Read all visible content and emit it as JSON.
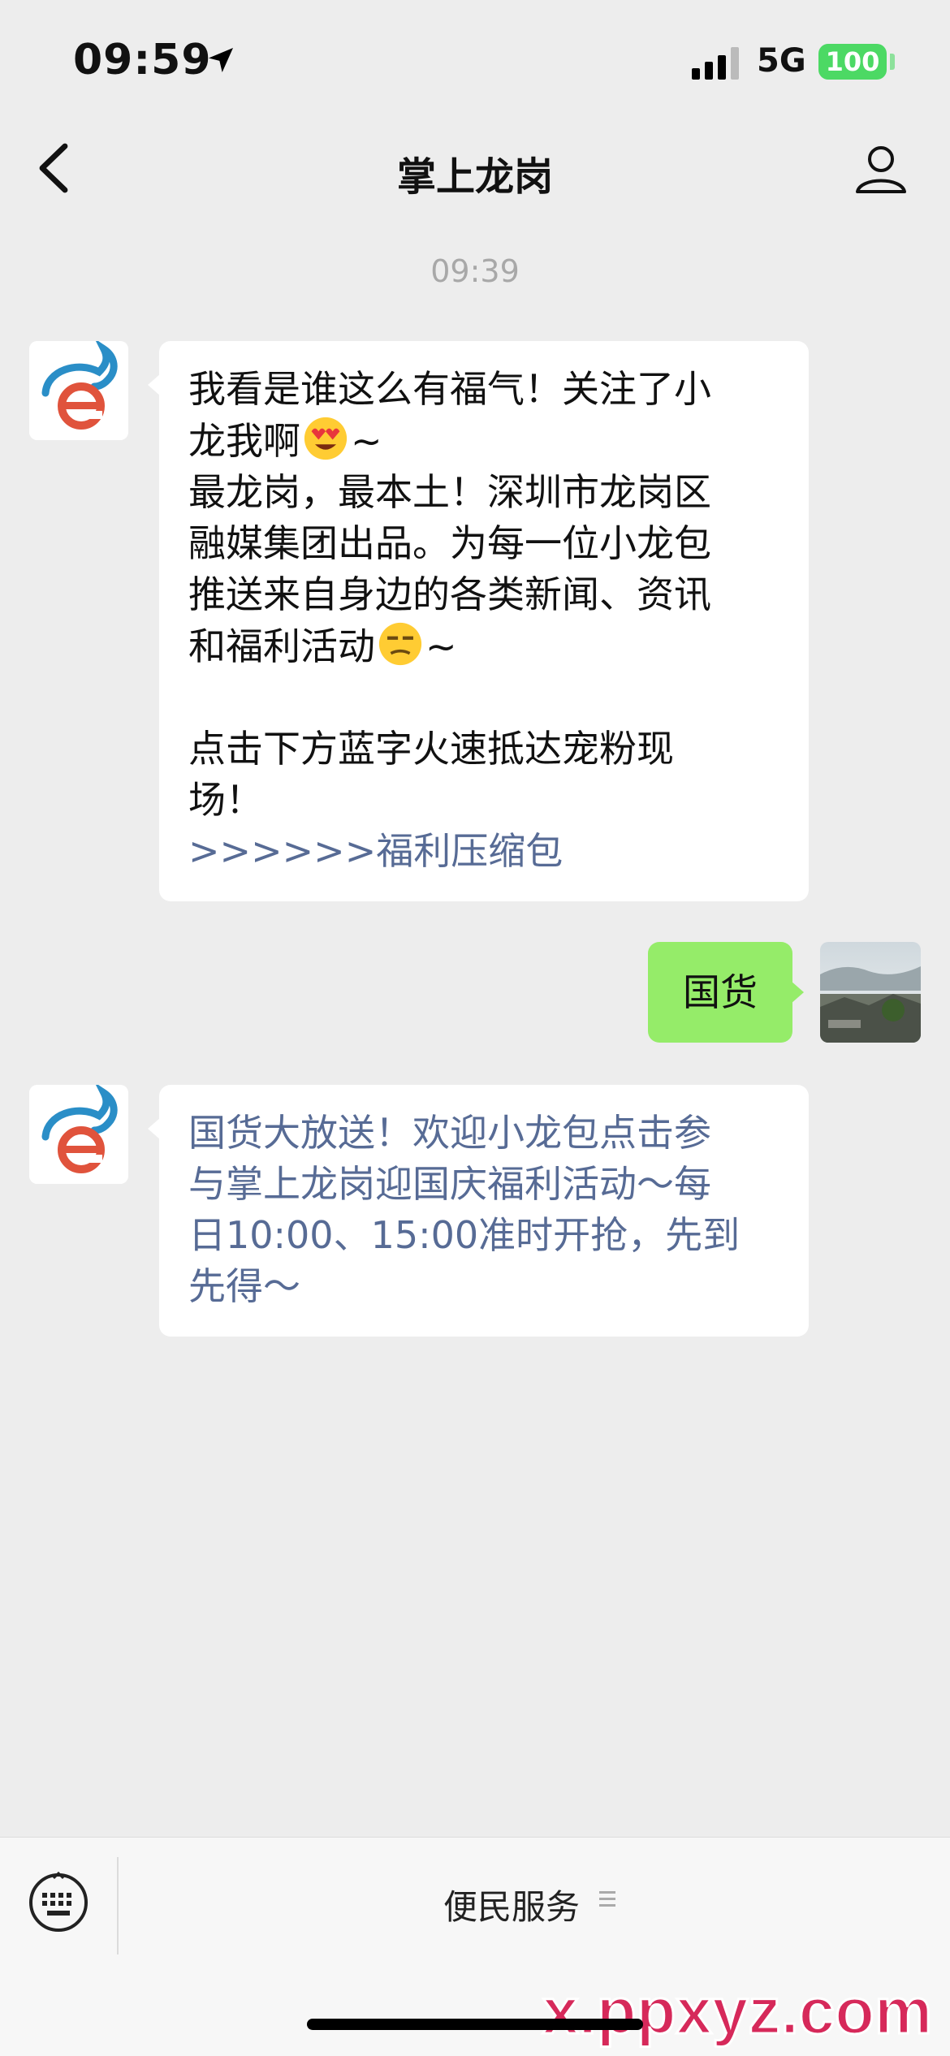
{
  "status_bar": {
    "time": "09:59",
    "network": "5G",
    "battery": "100"
  },
  "nav": {
    "title": "掌上龙岗"
  },
  "chat": {
    "timestamp": "09:39",
    "msg1": {
      "lines": [
        "我看是谁这么有福气！关注了小",
        "龙我啊",
        "最龙岗，最本土！深圳市龙岗区",
        "融媒集团出品。为每一位小龙包",
        "推送来自身边的各类新闻、资讯",
        "和福利活动",
        "点击下方蓝字火速抵达宠粉现",
        "场！"
      ],
      "tilde1": "~",
      "tilde2": "~",
      "link": ">>>>>>福利压缩包"
    },
    "msg2": {
      "text": "国货"
    },
    "msg3": {
      "lines": [
        "国货大放送！欢迎小龙包点击参",
        "与掌上龙岗迎国庆福利活动～每",
        "日10:00、15:00准时开抢，先到",
        "先得～"
      ]
    }
  },
  "bottom_menu": {
    "item": "便民服务"
  },
  "watermark": {
    "text": "x.ppxyz.com"
  }
}
